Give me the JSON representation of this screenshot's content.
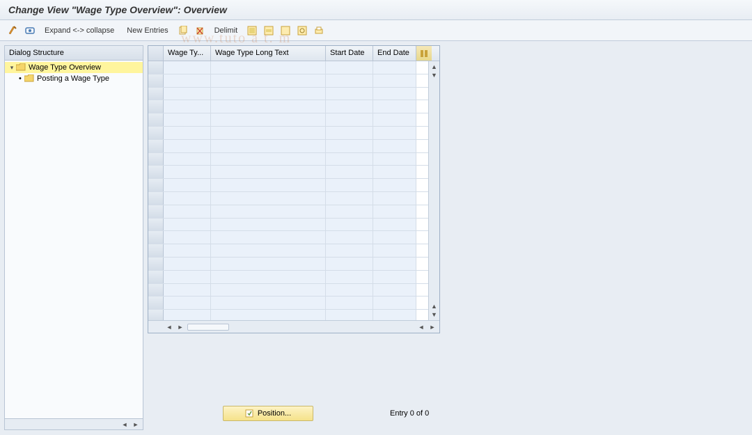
{
  "title": "Change View \"Wage Type Overview\": Overview",
  "toolbar": {
    "expand_collapse": "Expand <-> collapse",
    "new_entries": "New Entries",
    "delimit": "Delimit"
  },
  "sidebar": {
    "header": "Dialog Structure",
    "items": [
      {
        "label": "Wage Type Overview",
        "highlighted": true
      },
      {
        "label": "Posting a Wage Type",
        "highlighted": false
      }
    ]
  },
  "grid": {
    "columns": {
      "wage_type": "Wage Ty...",
      "wage_type_long": "Wage Type Long Text",
      "start_date": "Start Date",
      "end_date": "End Date"
    },
    "row_count": 20
  },
  "footer": {
    "position_label": "Position...",
    "entry_text": "Entry 0 of 0"
  },
  "watermark": "www.tuto   a   t.  m"
}
